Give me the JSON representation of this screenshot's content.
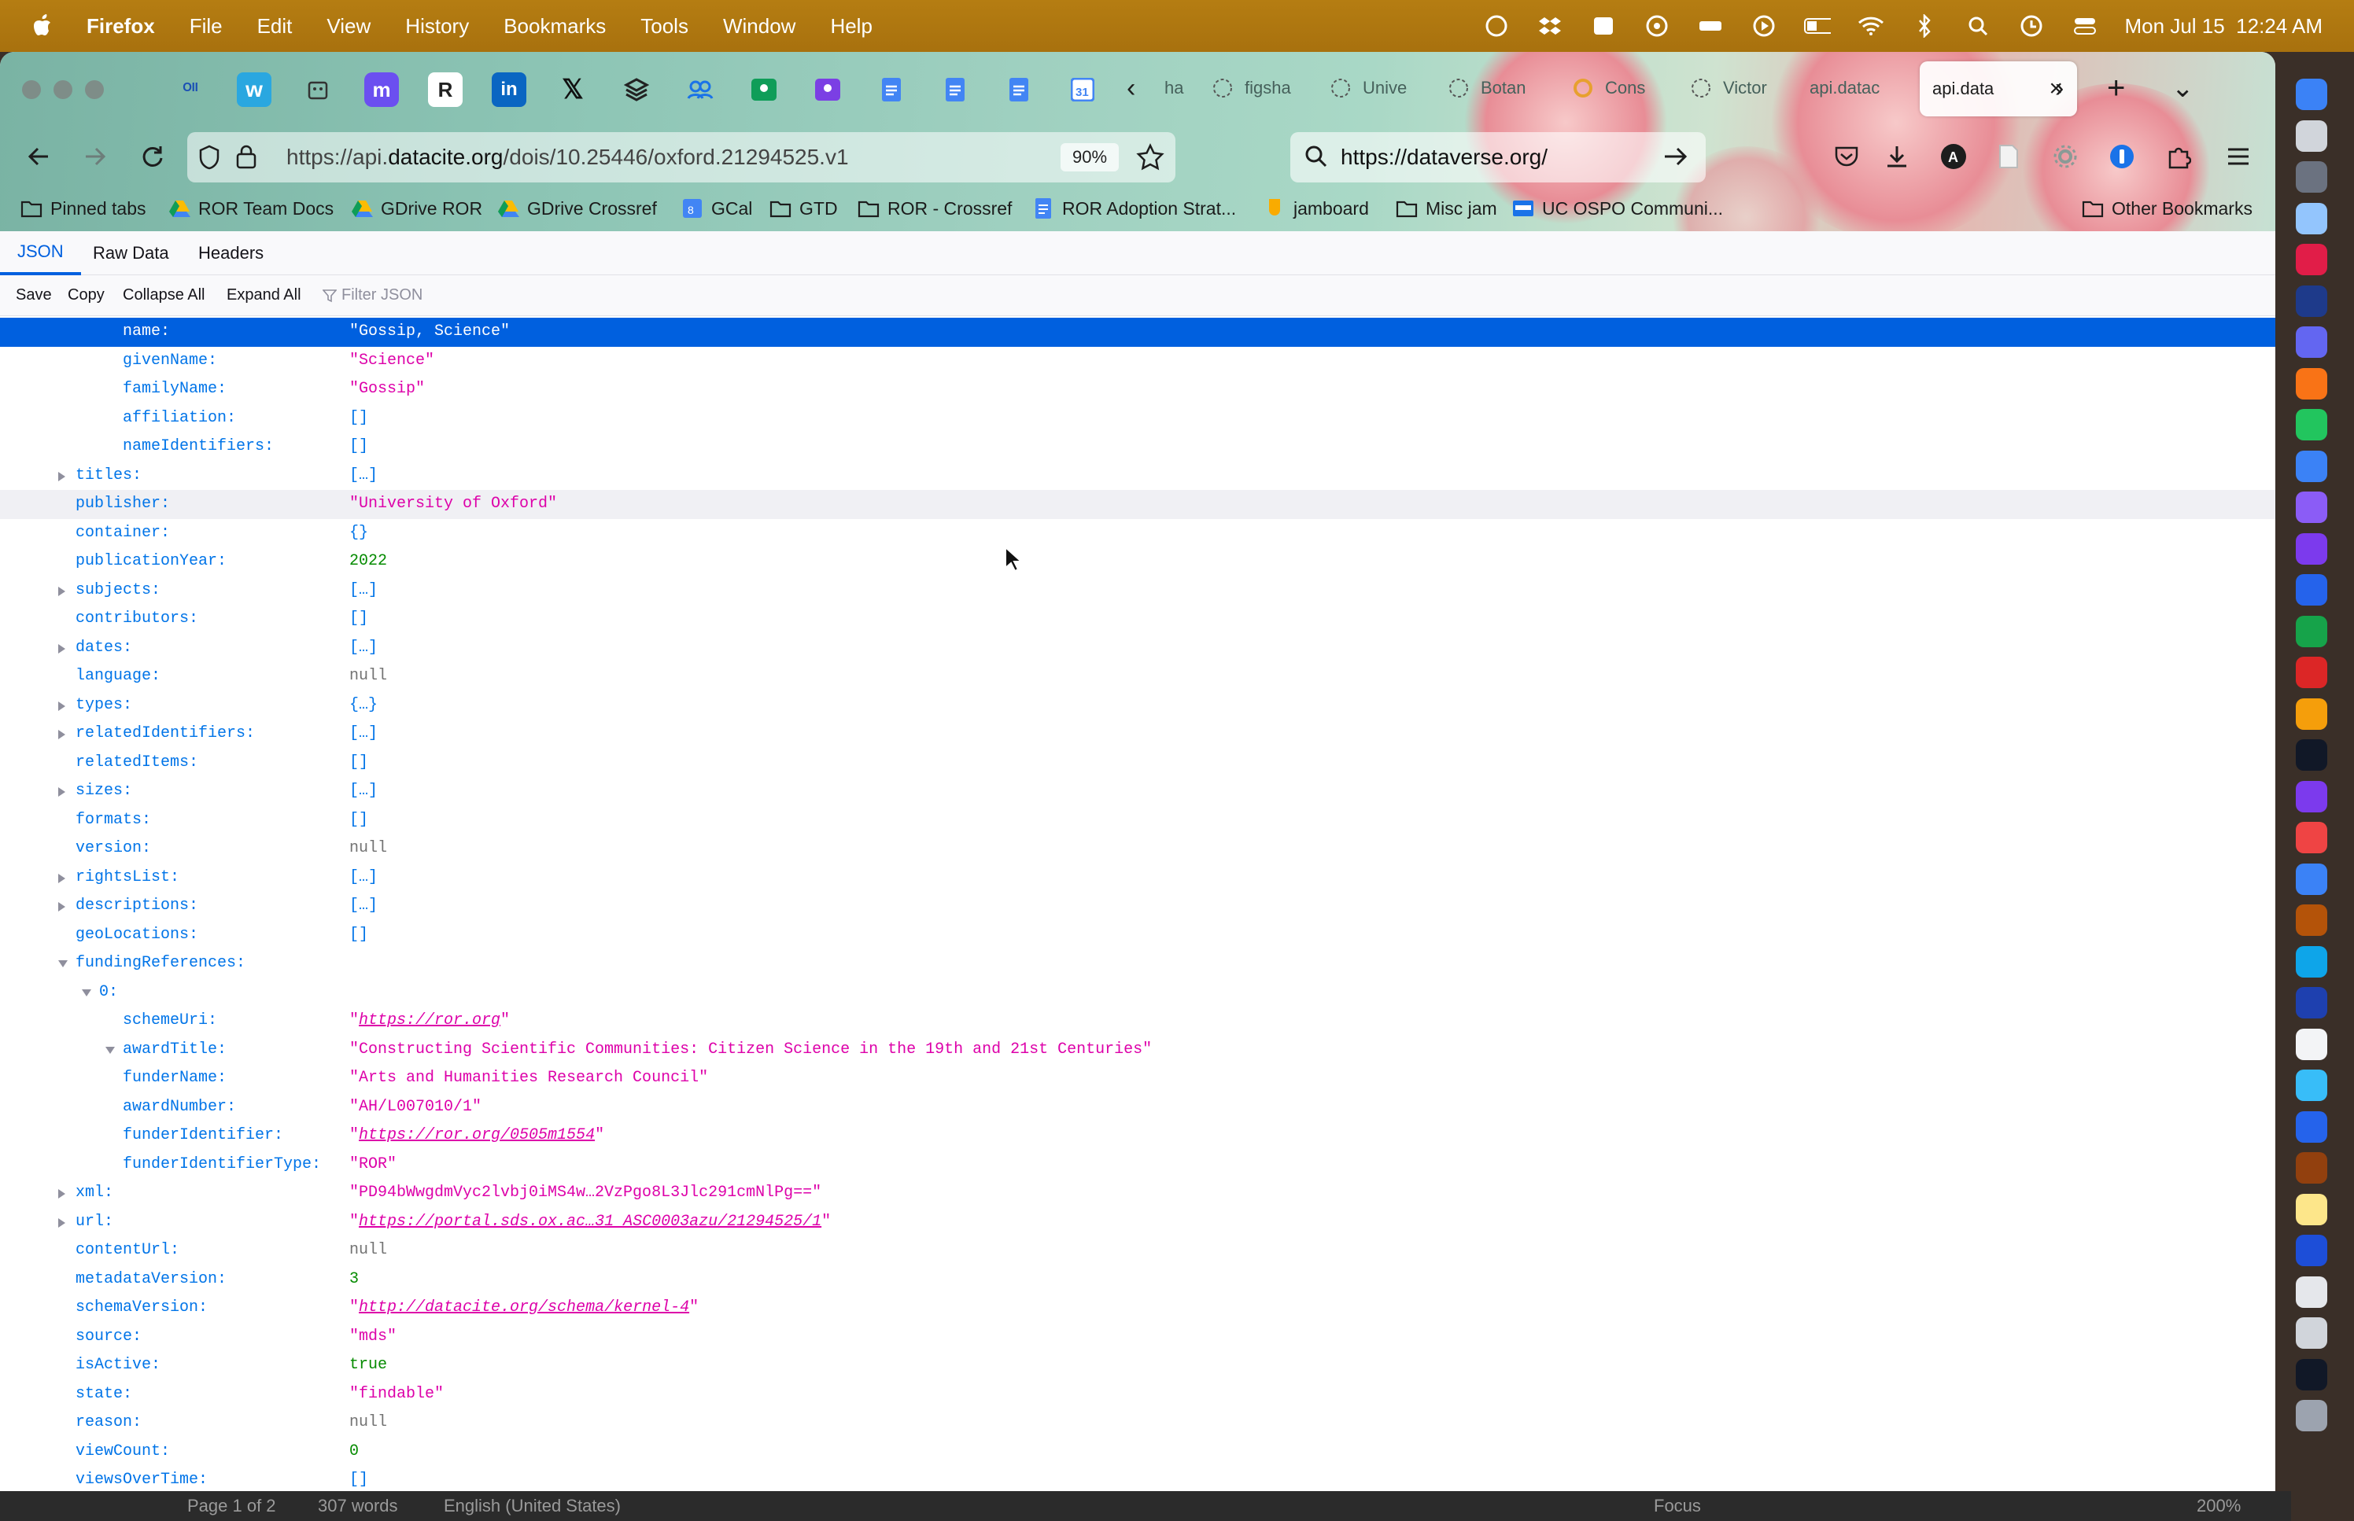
{
  "menubar": {
    "app": "Firefox",
    "items": [
      "File",
      "Edit",
      "View",
      "History",
      "Bookmarks",
      "Tools",
      "Window",
      "Help"
    ],
    "clock": "Mon Jul 15  12:24 AM"
  },
  "tabs": {
    "inactive": [
      "ha",
      "figsha",
      "Unive",
      "Botan",
      "Cons",
      "Victor",
      "api.datac"
    ],
    "active": "api.data",
    "close_glyph": "×",
    "new_tab_glyph": "+",
    "list_glyph": "⌄"
  },
  "nav": {
    "url_host": "https://api.",
    "url_domain": "datacite.org",
    "url_path": "/dois/10.25446/oxford.21294525.v1",
    "zoom": "90%",
    "search_value": "https://dataverse.org/"
  },
  "bookmarks": [
    {
      "label": "Pinned tabs",
      "icon": "folder-icon"
    },
    {
      "label": "ROR Team Docs",
      "icon": "gdrive-icon"
    },
    {
      "label": "GDrive ROR",
      "icon": "gdrive-icon"
    },
    {
      "label": "GDrive Crossref",
      "icon": "gdrive-icon"
    },
    {
      "label": "GCal",
      "icon": "calendar-icon"
    },
    {
      "label": "GTD",
      "icon": "folder-icon"
    },
    {
      "label": "ROR - Crossref",
      "icon": "folder-icon"
    },
    {
      "label": "ROR Adoption Strat...",
      "icon": "doc-icon"
    },
    {
      "label": "jamboard",
      "icon": "jamboard-icon"
    },
    {
      "label": "Misc jam",
      "icon": "folder-icon"
    },
    {
      "label": "UC OSPO Communi...",
      "icon": "doc-icon"
    },
    {
      "label": "Other Bookmarks",
      "icon": "folder-icon"
    }
  ],
  "viewer": {
    "tabs": [
      "JSON",
      "Raw Data",
      "Headers"
    ],
    "toolbar": [
      "Save",
      "Copy",
      "Collapse All",
      "Expand All"
    ],
    "filter_placeholder": "Filter JSON"
  },
  "json_rows": [
    {
      "key": "name:",
      "value": "\"Gossip, Science\"",
      "type": "str",
      "indent": 2,
      "tw": "",
      "selected": true
    },
    {
      "key": "givenName:",
      "value": "\"Science\"",
      "type": "str",
      "indent": 2,
      "tw": ""
    },
    {
      "key": "familyName:",
      "value": "\"Gossip\"",
      "type": "str",
      "indent": 2,
      "tw": ""
    },
    {
      "key": "affiliation:",
      "value": "[]",
      "type": "brk",
      "indent": 2,
      "tw": ""
    },
    {
      "key": "nameIdentifiers:",
      "value": "[]",
      "type": "brk",
      "indent": 2,
      "tw": ""
    },
    {
      "key": "titles:",
      "value": "[…]",
      "type": "brk",
      "indent": 1,
      "tw": "c"
    },
    {
      "key": "publisher:",
      "value": "\"University of Oxford\"",
      "type": "str",
      "indent": 1,
      "tw": "",
      "hover": true
    },
    {
      "key": "container:",
      "value": "{}",
      "type": "brk",
      "indent": 1,
      "tw": ""
    },
    {
      "key": "publicationYear:",
      "value": "2022",
      "type": "num",
      "indent": 1,
      "tw": ""
    },
    {
      "key": "subjects:",
      "value": "[…]",
      "type": "brk",
      "indent": 1,
      "tw": "c"
    },
    {
      "key": "contributors:",
      "value": "[]",
      "type": "brk",
      "indent": 1,
      "tw": ""
    },
    {
      "key": "dates:",
      "value": "[…]",
      "type": "brk",
      "indent": 1,
      "tw": "c"
    },
    {
      "key": "language:",
      "value": "null",
      "type": "nul",
      "indent": 1,
      "tw": ""
    },
    {
      "key": "types:",
      "value": "{…}",
      "type": "brk",
      "indent": 1,
      "tw": "c"
    },
    {
      "key": "relatedIdentifiers:",
      "value": "[…]",
      "type": "brk",
      "indent": 1,
      "tw": "c"
    },
    {
      "key": "relatedItems:",
      "value": "[]",
      "type": "brk",
      "indent": 1,
      "tw": ""
    },
    {
      "key": "sizes:",
      "value": "[…]",
      "type": "brk",
      "indent": 1,
      "tw": "c"
    },
    {
      "key": "formats:",
      "value": "[]",
      "type": "brk",
      "indent": 1,
      "tw": ""
    },
    {
      "key": "version:",
      "value": "null",
      "type": "nul",
      "indent": 1,
      "tw": ""
    },
    {
      "key": "rightsList:",
      "value": "[…]",
      "type": "brk",
      "indent": 1,
      "tw": "c"
    },
    {
      "key": "descriptions:",
      "value": "[…]",
      "type": "brk",
      "indent": 1,
      "tw": "c"
    },
    {
      "key": "geoLocations:",
      "value": "[]",
      "type": "brk",
      "indent": 1,
      "tw": ""
    },
    {
      "key": "fundingReferences:",
      "value": "",
      "type": "brk",
      "indent": 1,
      "tw": "o"
    },
    {
      "key": "0:",
      "value": "",
      "type": "brk",
      "indent": 1.5,
      "tw": "o"
    },
    {
      "key": "schemeUri:",
      "value": "https://ror.org",
      "type": "lnk",
      "indent": 2,
      "tw": ""
    },
    {
      "key": "awardTitle:",
      "value": "\"Constructing Scientific Communities: Citizen Science in the 19th and 21st Centuries\"",
      "type": "str",
      "indent": 2,
      "tw": "o"
    },
    {
      "key": "funderName:",
      "value": "\"Arts and Humanities Research Council\"",
      "type": "str",
      "indent": 2,
      "tw": ""
    },
    {
      "key": "awardNumber:",
      "value": "\"AH/L007010/1\"",
      "type": "str",
      "indent": 2,
      "tw": ""
    },
    {
      "key": "funderIdentifier:",
      "value": "https://ror.org/0505m1554",
      "type": "lnk",
      "indent": 2,
      "tw": ""
    },
    {
      "key": "funderIdentifierType:",
      "value": "\"ROR\"",
      "type": "str",
      "indent": 2,
      "tw": ""
    },
    {
      "key": "xml:",
      "value": "\"PD94bWwgdmVyc2lvbj0iMS4w…2VzPgo8L3Jlc291cmNlPg==\"",
      "type": "str",
      "indent": 1,
      "tw": "c"
    },
    {
      "key": "url:",
      "value": "https://portal.sds.ox.ac…31_ASC0003azu/21294525/1",
      "type": "lnk",
      "indent": 1,
      "tw": "c"
    },
    {
      "key": "contentUrl:",
      "value": "null",
      "type": "nul",
      "indent": 1,
      "tw": ""
    },
    {
      "key": "metadataVersion:",
      "value": "3",
      "type": "num",
      "indent": 1,
      "tw": ""
    },
    {
      "key": "schemaVersion:",
      "value": "http://datacite.org/schema/kernel-4",
      "type": "lnk",
      "indent": 1,
      "tw": ""
    },
    {
      "key": "source:",
      "value": "\"mds\"",
      "type": "str",
      "indent": 1,
      "tw": ""
    },
    {
      "key": "isActive:",
      "value": "true",
      "type": "bool",
      "indent": 1,
      "tw": ""
    },
    {
      "key": "state:",
      "value": "\"findable\"",
      "type": "str",
      "indent": 1,
      "tw": ""
    },
    {
      "key": "reason:",
      "value": "null",
      "type": "nul",
      "indent": 1,
      "tw": ""
    },
    {
      "key": "viewCount:",
      "value": "0",
      "type": "num",
      "indent": 1,
      "tw": ""
    },
    {
      "key": "viewsOverTime:",
      "value": "[]",
      "type": "brk",
      "indent": 1,
      "tw": ""
    }
  ],
  "background_app_bar": {
    "page": "Page 1 of 2",
    "words": "307 words",
    "lang": "English (United States)",
    "focus": "Focus",
    "zoom": "200%"
  },
  "colors": {
    "menubar": "#b57d12",
    "selected_row": "#0060df",
    "json_key": "#0074e8",
    "json_string": "#dd00a9",
    "json_number": "#058b00"
  }
}
